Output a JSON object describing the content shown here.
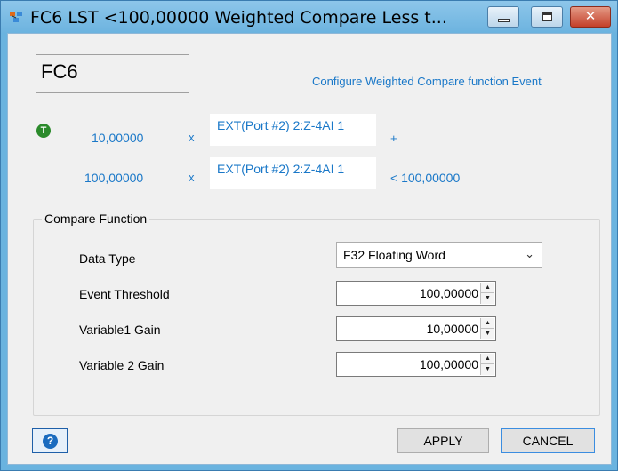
{
  "window": {
    "title": "FC6 LST <100,00000 Weighted Compare Less t...",
    "controls": {
      "minimize": "minimize-icon",
      "maximize": "maximize-icon",
      "close": "✕"
    }
  },
  "header": {
    "name": "FC6",
    "description": "Configure Weighted Compare function Event"
  },
  "formula": {
    "trigger_icon_text": "T",
    "term1": {
      "coefficient": "10,00000",
      "operator": "x",
      "variable": "EXT(Port #2) 2:Z-4AI 1",
      "suffix": "+"
    },
    "term2": {
      "coefficient": "100,00000",
      "operator": "x",
      "variable": "EXT(Port #2) 2:Z-4AI 1",
      "suffix": "< 100,00000"
    }
  },
  "compare_function": {
    "legend": "Compare Function",
    "data_type": {
      "label": "Data Type",
      "value": "F32 Floating Word"
    },
    "event_threshold": {
      "label": "Event Threshold",
      "value": "100,00000"
    },
    "variable1_gain": {
      "label": "Variable1 Gain",
      "value": "10,00000"
    },
    "variable2_gain": {
      "label": "Variable 2 Gain",
      "value": "100,00000"
    }
  },
  "footer": {
    "help_icon_text": "?",
    "apply_label": "APPLY",
    "cancel_label": "CANCEL"
  },
  "colors": {
    "link_blue": "#1a78c8",
    "trigger_green": "#2b8a2b",
    "window_frame": "#6ab3df"
  }
}
